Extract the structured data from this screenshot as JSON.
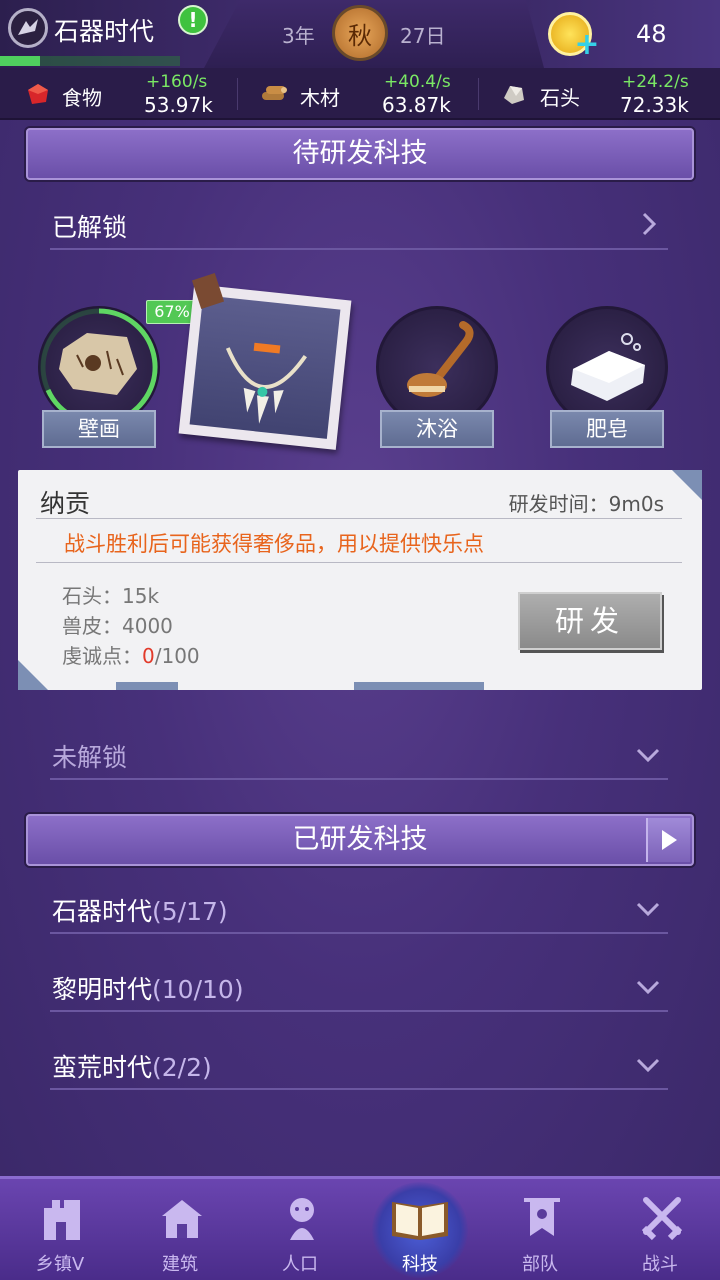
{
  "header": {
    "era_title": "石器时代",
    "alert_icon": "exclamation-icon",
    "year": "3年",
    "season": "秋",
    "day": "27日",
    "coins": "48"
  },
  "resources": [
    {
      "icon": "meat-icon",
      "name": "食物",
      "rate": "+160/s",
      "value": "53.97k"
    },
    {
      "icon": "wood-icon",
      "name": "木材",
      "rate": "+40.4/s",
      "value": "63.87k"
    },
    {
      "icon": "stone-icon",
      "name": "石头",
      "rate": "+24.2/s",
      "value": "72.33k"
    }
  ],
  "pending": {
    "header": "待研发科技",
    "unlocked_label": "已解锁",
    "progress": "67%",
    "techs": [
      {
        "label": "壁画"
      },
      {
        "label": "沐浴"
      },
      {
        "label": "肥皂"
      }
    ],
    "locked_label": "未解锁"
  },
  "detail": {
    "title": "纳贡",
    "time_label": "研发时间：9m0s",
    "description": "战斗胜利后可能获得奢侈品，用以提供快乐点",
    "costs": {
      "stone": "石头：15k",
      "hide": "兽皮：4000",
      "piety_label": "虔诚点：",
      "piety_current": "0",
      "piety_total": "/100"
    },
    "research_button": "研发"
  },
  "researched": {
    "header": "已研发科技",
    "eras": [
      {
        "name": "石器时代",
        "count": "(5/17)"
      },
      {
        "name": "黎明时代",
        "count": "(10/10)"
      },
      {
        "name": "蛮荒时代",
        "count": "(2/2)"
      }
    ]
  },
  "nav": [
    {
      "label": "乡镇V",
      "icon": "town-icon"
    },
    {
      "label": "建筑",
      "icon": "house-icon"
    },
    {
      "label": "人口",
      "icon": "person-icon"
    },
    {
      "label": "科技",
      "icon": "book-icon"
    },
    {
      "label": "部队",
      "icon": "banner-icon"
    },
    {
      "label": "战斗",
      "icon": "crossed-swords-icon"
    }
  ],
  "colors": {
    "accent_green": "#7ae864",
    "description_orange": "#e8641c",
    "piety_red": "#e23a2a"
  }
}
